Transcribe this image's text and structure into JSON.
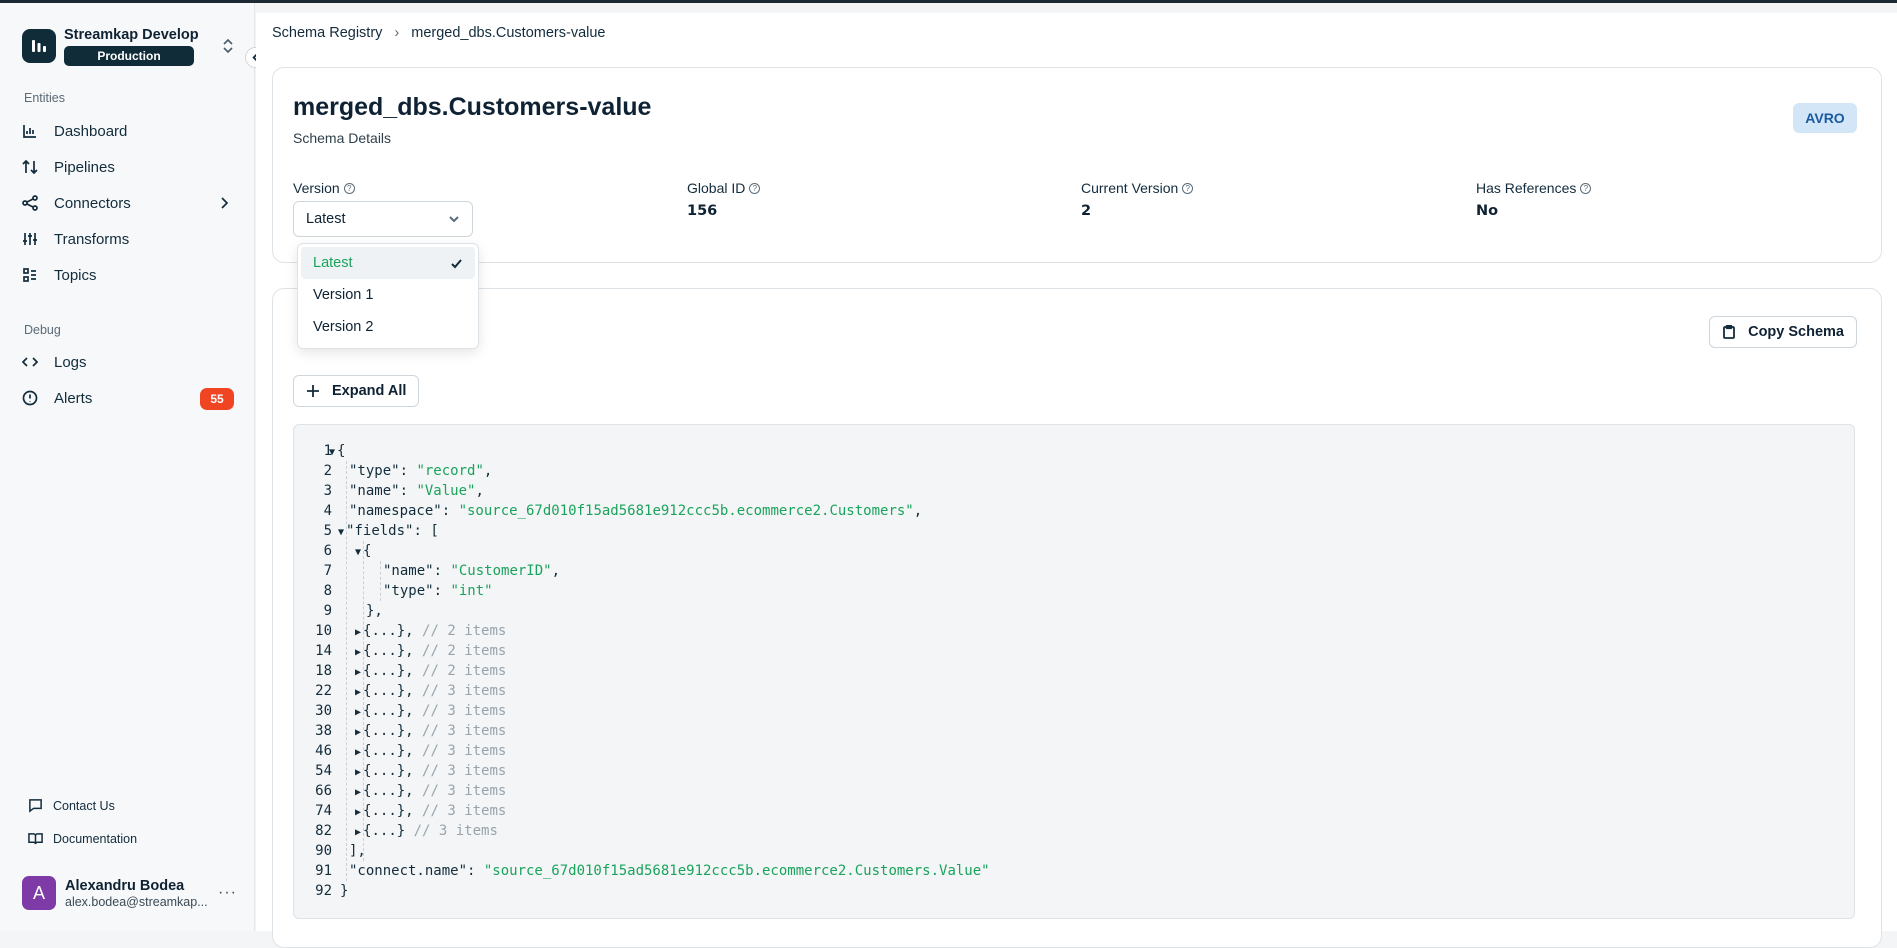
{
  "org": {
    "name": "Streamkap Develop",
    "environment": "Production"
  },
  "sidebar": {
    "entities_label": "Entities",
    "debug_label": "Debug",
    "entities": [
      {
        "label": "Dashboard",
        "icon": "chart-icon"
      },
      {
        "label": "Pipelines",
        "icon": "arrows-updown-icon"
      },
      {
        "label": "Connectors",
        "icon": "share-icon"
      },
      {
        "label": "Transforms",
        "icon": "sliders-icon"
      },
      {
        "label": "Topics",
        "icon": "list-icon"
      }
    ],
    "debug": [
      {
        "label": "Logs",
        "icon": "code-icon"
      },
      {
        "label": "Alerts",
        "icon": "alert-circle-icon",
        "badge": "55"
      }
    ],
    "contact_label": "Contact Us",
    "docs_label": "Documentation"
  },
  "user": {
    "initial": "A",
    "name": "Alexandru Bodea",
    "email": "alex.bodea@streamkap..."
  },
  "breadcrumb": {
    "root": "Schema Registry",
    "current": "merged_dbs.Customers-value"
  },
  "schema": {
    "title": "merged_dbs.Customers-value",
    "subtitle": "Schema Details",
    "format": "AVRO",
    "version_label": "Version",
    "version_value": "Latest",
    "global_id_label": "Global ID",
    "global_id": "156",
    "current_version_label": "Current Version",
    "current_version": "2",
    "has_refs_label": "Has References",
    "has_refs": "No"
  },
  "dropdown": {
    "options": [
      "Latest",
      "Version 1",
      "Version 2"
    ],
    "selected": "Latest"
  },
  "buttons": {
    "copy": "Copy Schema",
    "expand": "Expand All"
  },
  "code": {
    "lines": [
      {
        "n": "1",
        "key": "",
        "val": "",
        "raw": "{",
        "tri": "down",
        "indent": 0
      },
      {
        "n": "2",
        "raw_key": "\"type\": ",
        "raw_val": "\"record\"",
        "tail": ",",
        "indent": 1
      },
      {
        "n": "3",
        "raw_key": "\"name\": ",
        "raw_val": "\"Value\"",
        "tail": ",",
        "indent": 1
      },
      {
        "n": "4",
        "raw_key": "\"namespace\": ",
        "raw_val": "\"source_67d010f15ad5681e912ccc5b.ecommerce2.Customers\"",
        "tail": ",",
        "indent": 1
      },
      {
        "n": "5",
        "raw_key": "\"fields\": [",
        "raw_val": "",
        "tail": "",
        "indent": 1,
        "tri": "down"
      },
      {
        "n": "6",
        "raw_key": "{",
        "raw_val": "",
        "tail": "",
        "indent": 2,
        "tri": "down"
      },
      {
        "n": "7",
        "raw_key": "\"name\": ",
        "raw_val": "\"CustomerID\"",
        "tail": ",",
        "indent": 3
      },
      {
        "n": "8",
        "raw_key": "\"type\": ",
        "raw_val": "\"int\"",
        "tail": "",
        "indent": 3
      },
      {
        "n": "9",
        "raw_key": "},",
        "raw_val": "",
        "tail": "",
        "indent": 2
      },
      {
        "n": "10",
        "raw_key": "{...}, ",
        "comment": "// 2 items",
        "indent": 2,
        "tri": "right"
      },
      {
        "n": "14",
        "raw_key": "{...}, ",
        "comment": "// 2 items",
        "indent": 2,
        "tri": "right"
      },
      {
        "n": "18",
        "raw_key": "{...}, ",
        "comment": "// 2 items",
        "indent": 2,
        "tri": "right"
      },
      {
        "n": "22",
        "raw_key": "{...}, ",
        "comment": "// 3 items",
        "indent": 2,
        "tri": "right"
      },
      {
        "n": "30",
        "raw_key": "{...}, ",
        "comment": "// 3 items",
        "indent": 2,
        "tri": "right"
      },
      {
        "n": "38",
        "raw_key": "{...}, ",
        "comment": "// 3 items",
        "indent": 2,
        "tri": "right"
      },
      {
        "n": "46",
        "raw_key": "{...}, ",
        "comment": "// 3 items",
        "indent": 2,
        "tri": "right"
      },
      {
        "n": "54",
        "raw_key": "{...}, ",
        "comment": "// 3 items",
        "indent": 2,
        "tri": "right"
      },
      {
        "n": "66",
        "raw_key": "{...}, ",
        "comment": "// 3 items",
        "indent": 2,
        "tri": "right"
      },
      {
        "n": "74",
        "raw_key": "{...}, ",
        "comment": "// 3 items",
        "indent": 2,
        "tri": "right"
      },
      {
        "n": "82",
        "raw_key": "{...} ",
        "comment": "// 3 items",
        "indent": 2,
        "tri": "right"
      },
      {
        "n": "90",
        "raw_key": "],",
        "raw_val": "",
        "tail": "",
        "indent": 1
      },
      {
        "n": "91",
        "raw_key": "\"connect.name\": ",
        "raw_val": "\"source_67d010f15ad5681e912ccc5b.ecommerce2.Customers.Value\"",
        "tail": "",
        "indent": 1
      },
      {
        "n": "92",
        "raw_key": "}",
        "raw_val": "",
        "tail": "",
        "indent": 0
      }
    ]
  },
  "colors": {
    "accent_green": "#1aa35c",
    "brand_dark": "#0f2c38",
    "alert_badge": "#ef4523",
    "avro_bg": "#d3e6f7"
  }
}
